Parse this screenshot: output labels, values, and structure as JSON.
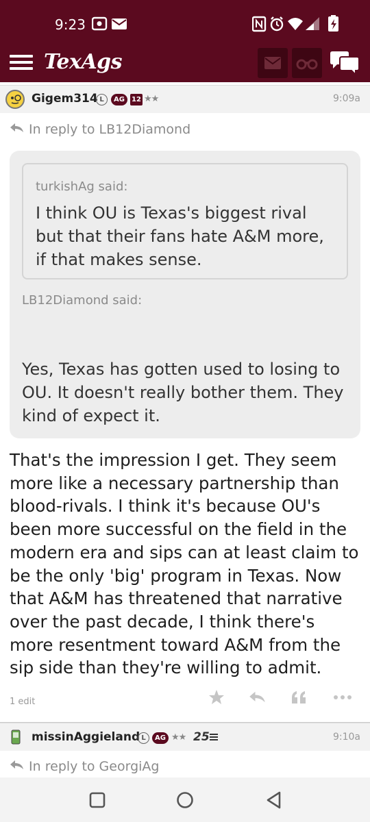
{
  "status_bar": {
    "time": "9:23"
  },
  "nav": {
    "brand": "TexAgs"
  },
  "post1": {
    "username": "Gigem314",
    "badge_l": "L",
    "badge_ag": "AG",
    "badge_num": "12",
    "stars": "★★",
    "time": "9:09a",
    "reply_to": "In reply to LB12Diamond",
    "inner_quote_author": "turkishAg said:",
    "inner_quote_text": "I think OU is Texas's biggest rival but that their fans hate A&M more, if that makes sense.",
    "quote_author": "LB12Diamond said:",
    "quote_text": "Yes, Texas has gotten used to losing to OU. It doesn't really bother them. They kind of expect it.",
    "body": "That's the impression I get. They seem more like a necessary partnership than blood-rivals. I think it's because OU's been more successful on the field in the modern era and sips can at least claim to be the only 'big' program in Texas. Now that A&M has threatened that narrative over the past decade, I think there's more resentment toward A&M from the sip side than they're willing to admit.",
    "edits": "1 edit"
  },
  "post2": {
    "username": "missinAggieland",
    "badge_l": "L",
    "badge_ag": "AG",
    "stars": "★★",
    "years": "25",
    "time": "9:10a",
    "reply_to": "In reply to GeorgiAg"
  },
  "colors": {
    "maroon": "#5b0a1f",
    "maroon_dark": "#3e0613"
  }
}
